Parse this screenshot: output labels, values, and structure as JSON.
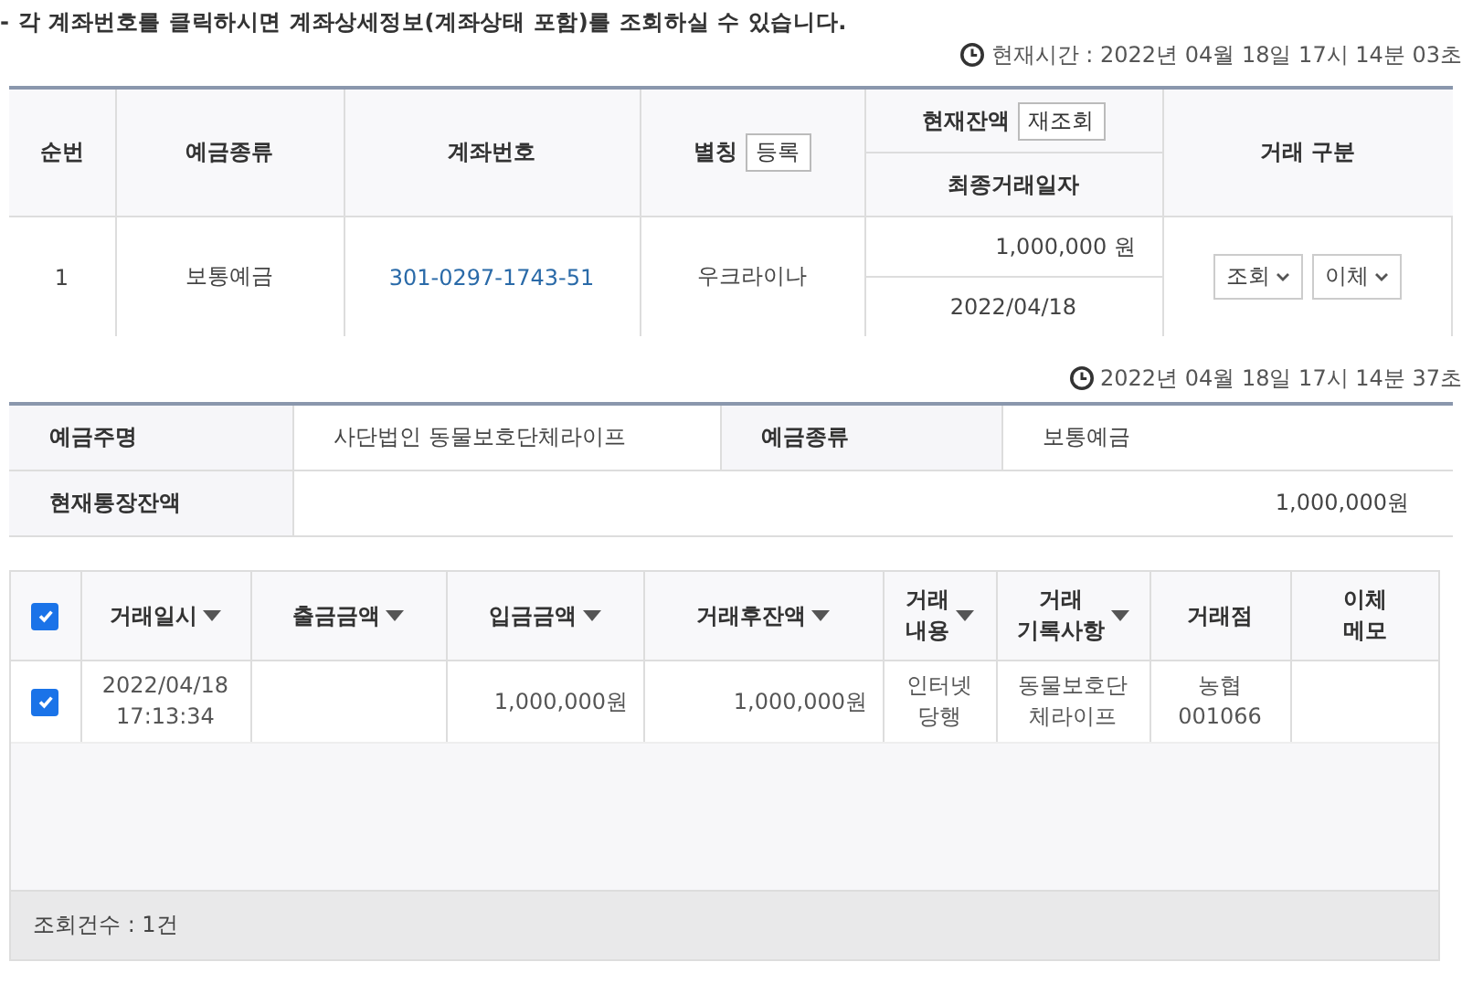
{
  "notice": "- 각 계좌번호를 클릭하시면 계좌상세정보(계좌상태 포함)를 조회하실 수 있습니다.",
  "current_time": "현재시간 : 2022년 04월 18일 17시 14분 03초",
  "accounts": {
    "columns": {
      "no": "순번",
      "type": "예금종류",
      "number": "계좌번호",
      "alias": "별칭",
      "alias_button": "등록",
      "balance": "현재잔액",
      "refresh_button": "재조회",
      "last_date": "최종거래일자",
      "action": "거래 구분"
    },
    "rows": [
      {
        "no": "1",
        "type": "보통예금",
        "number": "301-0297-1743-51",
        "alias": "우크라이나",
        "balance": "1,000,000 원",
        "last_date": "2022/04/18",
        "buttons": [
          "조회",
          "이체"
        ]
      }
    ]
  },
  "detail_time": "2022년 04월 18일 17시 14분 37초",
  "detail": {
    "holder_label": "예금주명",
    "holder": "사단법인 동물보호단체라이프",
    "type_label": "예금종류",
    "type": "보통예금",
    "balance_label": "현재통장잔액",
    "balance": "1,000,000원"
  },
  "transactions": {
    "all_checked": true,
    "columns": [
      {
        "label": "거래일시",
        "sortable": true
      },
      {
        "label": "출금금액",
        "sortable": true
      },
      {
        "label": "입금금액",
        "sortable": true
      },
      {
        "label": "거래후잔액",
        "sortable": true
      },
      {
        "label": "거래\n내용",
        "sortable": true
      },
      {
        "label": "거래\n기록사항",
        "sortable": true
      },
      {
        "label": "거래점",
        "sortable": false
      },
      {
        "label": "이체\n메모",
        "sortable": false
      }
    ],
    "rows": [
      {
        "checked": true,
        "cells": [
          "2022/04/18\n17:13:34",
          "",
          "1,000,000원",
          "1,000,000원",
          "인터넷\n당행",
          "동물보호단\n체라이프",
          "농협\n001066",
          ""
        ]
      }
    ],
    "count": "조회건수 : 1건"
  }
}
